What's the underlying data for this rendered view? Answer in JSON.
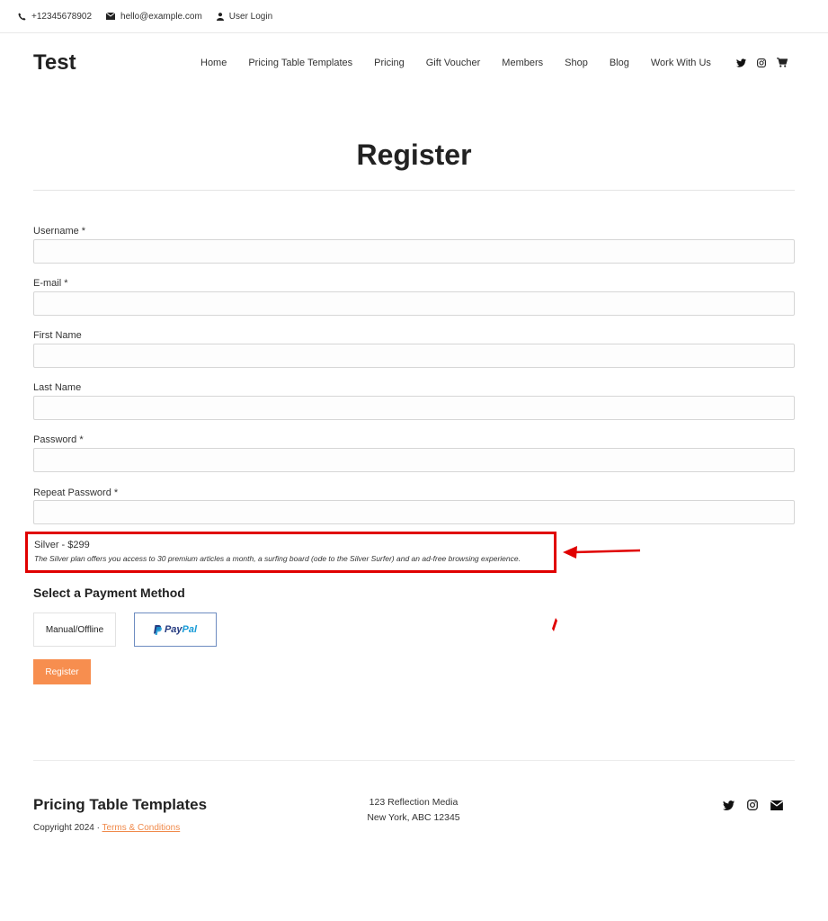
{
  "topbar": {
    "phone": "+12345678902",
    "email": "hello@example.com",
    "login": "User Login"
  },
  "header": {
    "logo": "Test",
    "nav": [
      "Home",
      "Pricing Table Templates",
      "Pricing",
      "Gift Voucher",
      "Members",
      "Shop",
      "Blog",
      "Work With Us"
    ],
    "icons": [
      "twitter-icon",
      "instagram-icon",
      "cart-icon"
    ]
  },
  "page": {
    "title": "Register"
  },
  "form": {
    "fields": [
      {
        "label": "Username *",
        "value": ""
      },
      {
        "label": "E-mail *",
        "value": ""
      },
      {
        "label": "First Name",
        "value": ""
      },
      {
        "label": "Last Name",
        "value": ""
      },
      {
        "label": "Password *",
        "value": ""
      },
      {
        "label": "Repeat Password *",
        "value": ""
      }
    ],
    "plan": {
      "name": "Silver - $299",
      "description": "The Silver plan offers you access to 30 premium articles a month, a surfing board (ode to the Silver Surfer) and an ad-free browsing experience."
    },
    "payment": {
      "title": "Select a Payment Method",
      "options": [
        "Manual/Offline",
        "PayPal"
      ],
      "paypal_pay": "Pay",
      "paypal_pal": "Pal",
      "selected": "PayPal"
    },
    "submit_label": "Register"
  },
  "annotation": {
    "highlight_color": "#e00000"
  },
  "footer": {
    "title": "Pricing Table Templates",
    "copyright": "Copyright 2024 · ",
    "terms": "Terms & Conditions",
    "address_line1": "123 Reflection Media",
    "address_line2": "New York, ABC 12345",
    "icons": [
      "twitter-icon",
      "instagram-icon",
      "email-icon"
    ]
  },
  "colors": {
    "accent": "#f78e4f",
    "link": "#f08a4b",
    "paypal_dark": "#253b80",
    "paypal_light": "#179bd7"
  }
}
